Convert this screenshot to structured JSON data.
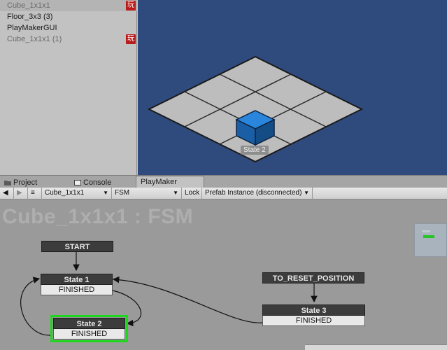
{
  "hierarchy": {
    "items": [
      {
        "label": "Cube_1x1x1",
        "badge": "玩"
      },
      {
        "label": "Floor_3x3 (3)"
      },
      {
        "label": "PlayMakerGUI"
      },
      {
        "label": "Cube_1x1x1 (1)",
        "badge": "玩"
      }
    ]
  },
  "scene": {
    "state_tag": "State 2",
    "background_color": "#2f4b7e",
    "cube_color": "#1a6fc2"
  },
  "tabs": [
    {
      "label": "Project",
      "icon": "folder-icon"
    },
    {
      "label": "Console",
      "icon": "console-icon"
    },
    {
      "label": "PlayMaker",
      "active": true
    }
  ],
  "toolbar": {
    "back_icon": "◀",
    "forward_icon": "▶",
    "menu_icon": "≡",
    "gameobject_select": "Cube_1x1x1",
    "fsm_select": "FSM",
    "lock_label": "Lock",
    "prefab_select": "Prefab Instance (disconnected)"
  },
  "fsm": {
    "title": "Cube_1x1x1 : FSM",
    "start_label": "START",
    "global_event": "TO_RESET_POSITION",
    "states": [
      {
        "name": "State 1",
        "event": "FINISHED"
      },
      {
        "name": "State 2",
        "event": "FINISHED",
        "active": true
      },
      {
        "name": "State 3",
        "event": "FINISHED"
      }
    ],
    "active_color": "#1fd61f"
  }
}
